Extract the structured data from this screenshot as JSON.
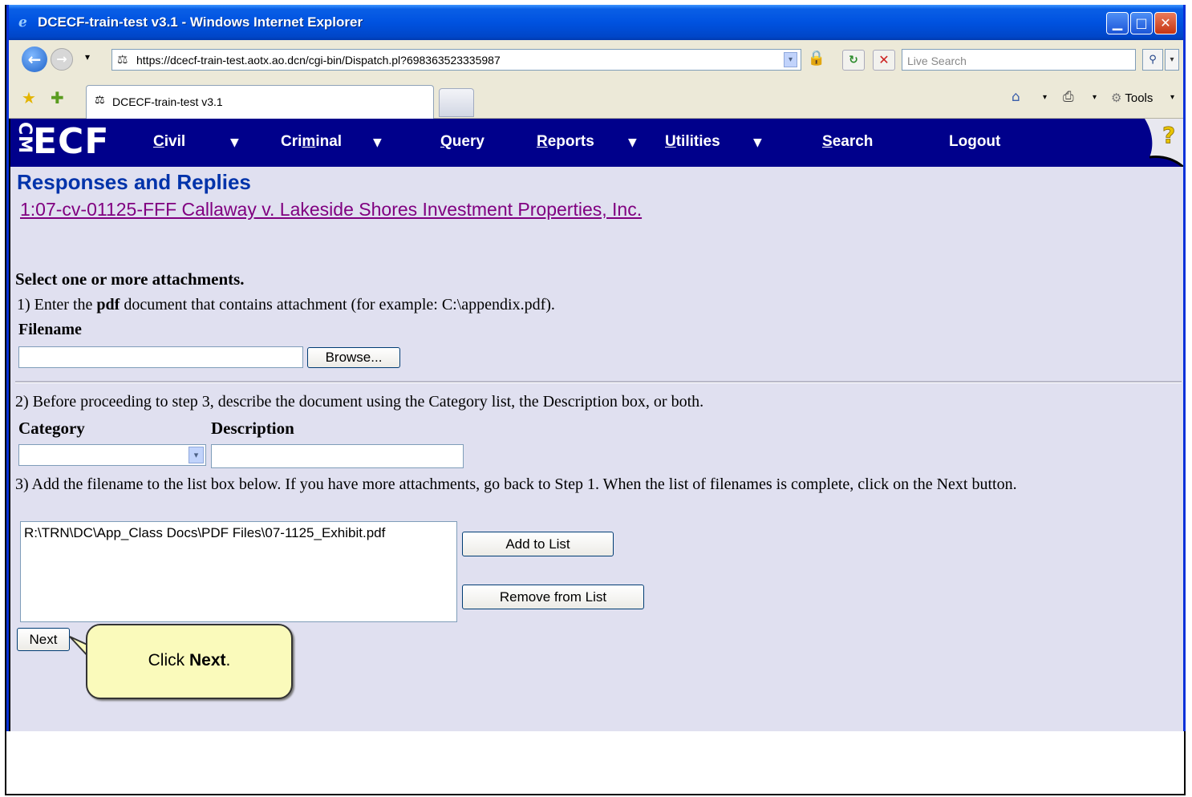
{
  "window": {
    "title": "DCECF-train-test v3.1 - Windows Internet Explorer"
  },
  "address_bar": {
    "url": "https://dcecf-train-test.aotx.ao.dcn/cgi-bin/Dispatch.pl?698363523335987"
  },
  "search": {
    "placeholder": "Live Search"
  },
  "tab": {
    "label": "DCECF-train-test v3.1"
  },
  "toolbar": {
    "tools_label": "Tools"
  },
  "ecf_menu": {
    "logo": "ECF",
    "items": [
      {
        "pre": "",
        "u": "C",
        "post": "ivil"
      },
      {
        "pre": "Cri",
        "u": "m",
        "post": "inal"
      },
      {
        "pre": "",
        "u": "Q",
        "post": "uery"
      },
      {
        "pre": "",
        "u": "R",
        "post": "eports"
      },
      {
        "pre": "",
        "u": "U",
        "post": "tilities"
      },
      {
        "pre": "",
        "u": "S",
        "post": "earch"
      },
      {
        "pre": "",
        "u": "",
        "post": "Logout"
      }
    ]
  },
  "page": {
    "title": "Responses and Replies",
    "case_link": "1:07-cv-01125-FFF Callaway v. Lakeside Shores Investment Properties, Inc.",
    "select_heading": "Select one or more attachments.",
    "step1_pre": "1) Enter the ",
    "step1_bold": "pdf",
    "step1_post": " document that contains attachment (for example: C:\\appendix.pdf).",
    "filename_label": "Filename",
    "browse_button": "Browse...",
    "step2": "2) Before proceeding to step 3, describe the document using the Category list, the Description box, or both.",
    "category_label": "Category",
    "description_label": "Description",
    "step3": "3) Add the filename to the list box below. If you have more attachments, go back to Step 1. When the list of filenames is complete, click on the Next button.",
    "file_list": [
      "R:\\TRN\\DC\\App_Class Docs\\PDF Files\\07-1125_Exhibit.pdf"
    ],
    "add_button": "Add to List",
    "remove_button": "Remove from List",
    "next_button": "Next"
  },
  "callout": {
    "pre": "Click ",
    "bold": "Next",
    "post": "."
  }
}
